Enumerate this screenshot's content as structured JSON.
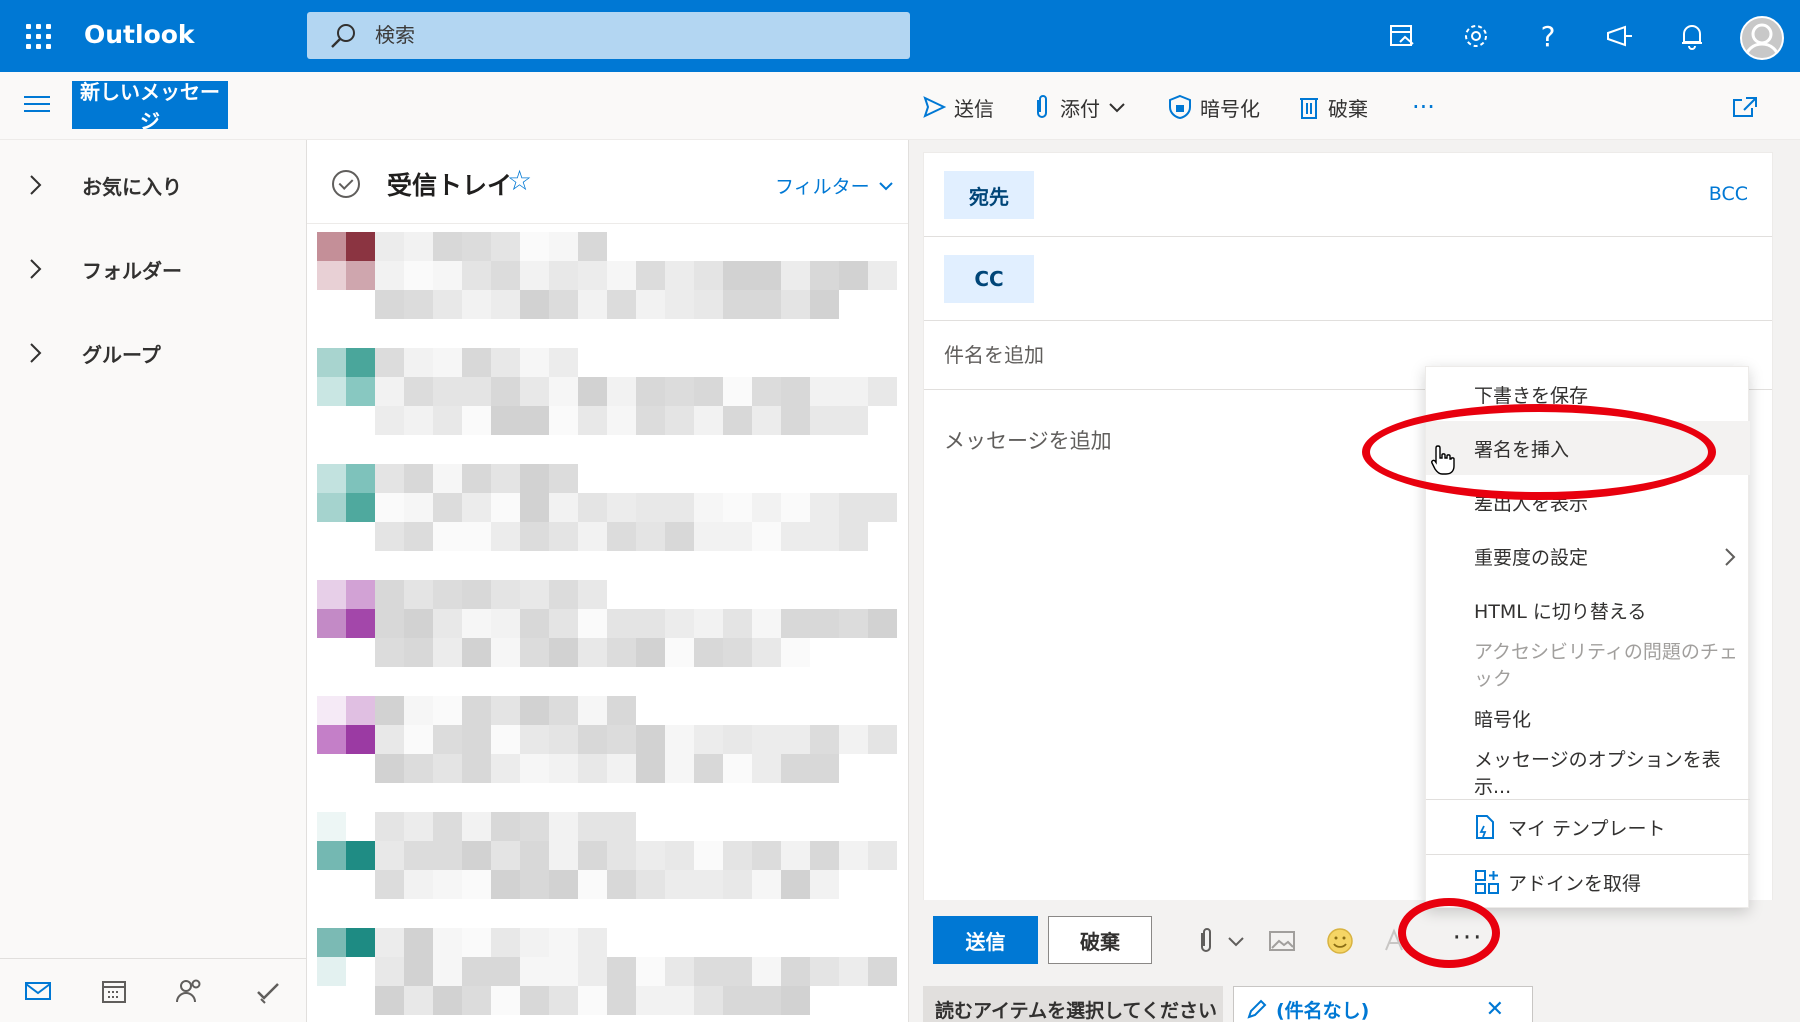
{
  "app": {
    "name": "Outlook"
  },
  "search": {
    "placeholder": "検索"
  },
  "topbar_icons": [
    "my-day-icon",
    "settings-icon",
    "help-icon",
    "whats-new-icon",
    "notifications-icon",
    "account-avatar"
  ],
  "toolbar": {
    "new_message": "新しいメッセージ",
    "send": "送信",
    "attach": "添付",
    "encrypt": "暗号化",
    "discard": "破棄",
    "more": "···"
  },
  "nav": {
    "items": [
      {
        "label": "お気に入り"
      },
      {
        "label": "フォルダー"
      },
      {
        "label": "グループ"
      }
    ],
    "apps": [
      "mail-icon",
      "calendar-icon",
      "people-icon",
      "todo-icon"
    ]
  },
  "message_list": {
    "title": "受信トレイ",
    "filter": "フィルター",
    "rows_count_visible": 7
  },
  "compose": {
    "to_label": "宛先",
    "cc_label": "CC",
    "bcc_label": "BCC",
    "subject_placeholder": "件名を追加",
    "body_placeholder": "メッセージを追加",
    "send": "送信",
    "discard": "破棄",
    "more": "···"
  },
  "tabs": {
    "reading": "読むアイテムを選択してください",
    "draft": "(件名なし)"
  },
  "overflow_menu": {
    "items": [
      {
        "label": "下書きを保存"
      },
      {
        "label": "署名を挿入"
      },
      {
        "label": "差出人を表示"
      },
      {
        "label": "重要度の設定"
      },
      {
        "label": "HTML に切り替える"
      },
      {
        "label": "アクセシビリティの問題のチェック"
      },
      {
        "label": "暗号化"
      },
      {
        "label": "メッセージのオプションを表示..."
      },
      {
        "label": "マイ テンプレート"
      },
      {
        "label": "アドインを取得"
      }
    ]
  },
  "colors": {
    "accent": "#0078d4",
    "annotation": "#e8000e"
  }
}
